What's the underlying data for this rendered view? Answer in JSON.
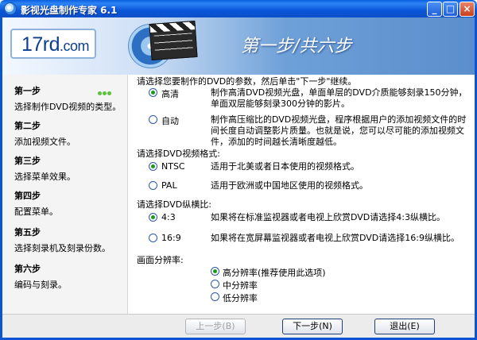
{
  "window": {
    "title": "影视光盘制作专家 6.1"
  },
  "header": {
    "logo": "17rd",
    "logo_suffix": ".com",
    "step_title": "第一步/共六步"
  },
  "sidebar": {
    "steps": [
      {
        "title": "第一步",
        "desc": "选择制作DVD视频的类型。"
      },
      {
        "title": "第二步",
        "desc": "添加视频文件。"
      },
      {
        "title": "第三步",
        "desc": "选择菜单效果。"
      },
      {
        "title": "第四步",
        "desc": "配置菜单。"
      },
      {
        "title": "第五步",
        "desc": "选择刻录机及刻录份数。"
      },
      {
        "title": "第六步",
        "desc": "编码与刻录。"
      }
    ]
  },
  "main": {
    "intro": "请选择您要制作的DVD的参数，然后单击\"下一步\"继续。",
    "quality": [
      {
        "label": "高清",
        "selected": true,
        "desc": "制作高清DVD视频光盘，单面单层的DVD介质能够刻录150分钟，单面双层能够刻录300分钟的影片。"
      },
      {
        "label": "自动",
        "selected": false,
        "desc": "制作高压缩比的DVD视频光盘，程序根据用户的添加视频文件的时间长度自动调整影片质量。也就是说，您可以尽可能的添加视频文件，添加的时间越长清晰度越低。"
      }
    ],
    "format_heading": "请选择DVD视频格式:",
    "formats": [
      {
        "label": "NTSC",
        "selected": true,
        "desc": "适用于北美或者日本使用的视频格式。"
      },
      {
        "label": "PAL",
        "selected": false,
        "desc": "适用于欧洲或中国地区使用的视频格式。"
      }
    ],
    "aspect_heading": "请选择DVD纵横比:",
    "aspects": [
      {
        "label": "4:3",
        "selected": true,
        "desc": "如果将在标准监视器或者电视上欣赏DVD请选择4:3纵横比。"
      },
      {
        "label": "16:9",
        "selected": false,
        "desc": "如果将在宽屏幕监视器或者电视上欣赏DVD请选择16:9纵横比。"
      }
    ],
    "resolution_heading": "画面分辨率:",
    "resolutions": [
      {
        "label": "高分辨率(推荐使用此选项)",
        "selected": true
      },
      {
        "label": "中分辨率",
        "selected": false
      },
      {
        "label": "低分辨率",
        "selected": false
      }
    ]
  },
  "footer": {
    "prev": "上一步(B)",
    "next": "下一步(N)",
    "exit": "退出(E)"
  }
}
